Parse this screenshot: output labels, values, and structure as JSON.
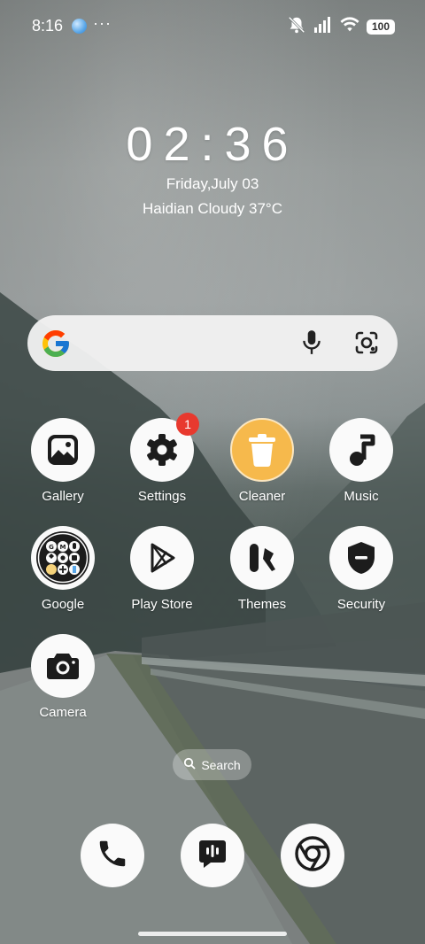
{
  "status_bar": {
    "time": "8:16",
    "more": "···",
    "battery": "100"
  },
  "clock": {
    "time": "02:36",
    "date": "Friday,July 03",
    "weather": "Haidian Cloudy 37°C"
  },
  "apps": {
    "gallery": "Gallery",
    "settings": "Settings",
    "settings_badge": "1",
    "cleaner": "Cleaner",
    "music": "Music",
    "google": "Google",
    "play_store": "Play Store",
    "themes": "Themes",
    "security": "Security",
    "camera": "Camera"
  },
  "search_pill": {
    "label": "Search"
  },
  "colors": {
    "badge": "#e8392e",
    "cleaner": "#f6b94c"
  }
}
